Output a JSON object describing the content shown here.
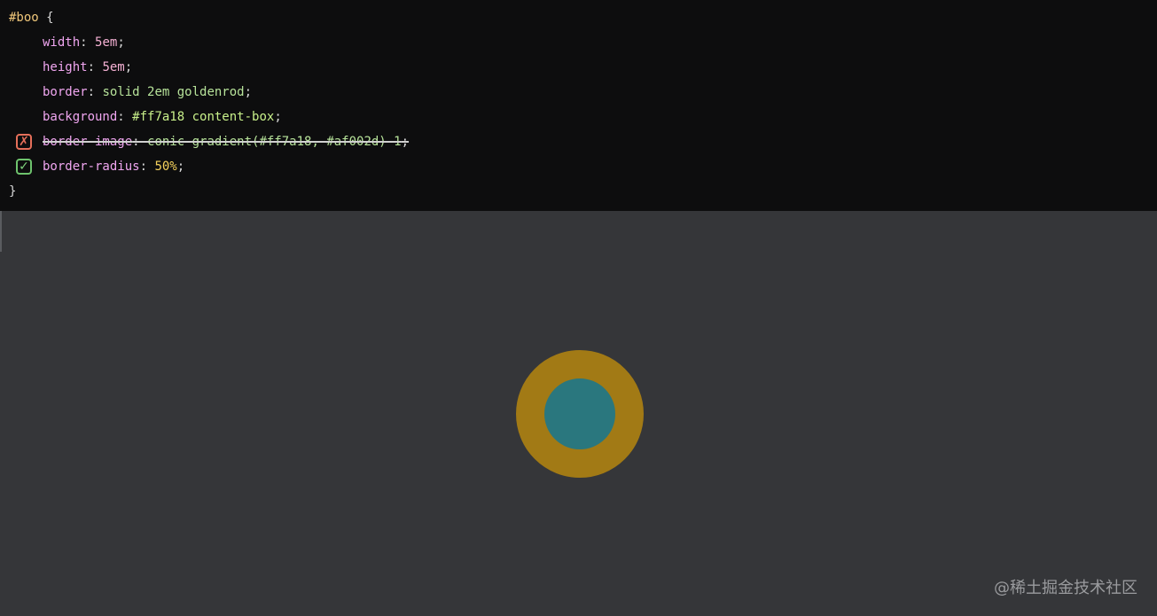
{
  "code": {
    "selector": "#boo",
    "open_brace": "{",
    "close_brace": "}",
    "lines": [
      {
        "property": "width",
        "value": "5em",
        "enabled": true
      },
      {
        "property": "height",
        "value": "5em",
        "enabled": true
      },
      {
        "property": "border",
        "value": "solid 2em goldenrod",
        "enabled": true
      },
      {
        "property": "background",
        "value": "#ff7a18 content-box",
        "enabled": true
      },
      {
        "property": "border-image",
        "value": "conic-gradient(#ff7a18, #af002d) 1",
        "enabled": false
      },
      {
        "property": "border-radius",
        "value": "50%",
        "enabled": true
      }
    ],
    "toggles": {
      "off_icon": "x-mark-icon",
      "off_glyph": "✗",
      "on_icon": "check-mark-icon",
      "on_glyph": "✓"
    }
  },
  "preview": {
    "element_id": "boo",
    "border_color": "#a27a15",
    "background_color": "#2a777e"
  },
  "colors": {
    "code_background": "#0d0d0e",
    "preview_background": "#353639",
    "toggle_off": "#e56f5a",
    "toggle_on": "#6ec36d"
  },
  "watermark": "@稀土掘金技术社区"
}
